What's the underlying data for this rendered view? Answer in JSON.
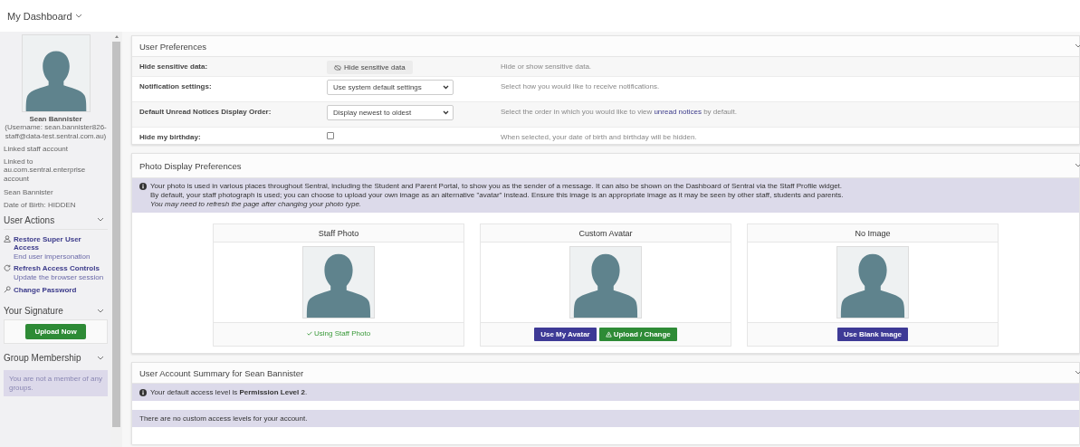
{
  "header": {
    "title": "My Dashboard"
  },
  "profile": {
    "name": "Sean Bannister",
    "username": "(Username: sean.bannister826-staff@data-test.sentral.com.au)",
    "linked": "Linked staff account",
    "linked_to": "Linked to au.com.sentral.enterprise account",
    "display_name": "Sean Bannister",
    "dob": "Date of Birth: HIDDEN"
  },
  "user_actions": {
    "title": "User Actions",
    "actions": [
      {
        "kind": "user",
        "label": "Restore Super User Access",
        "sub": "End user impersonation"
      },
      {
        "kind": "refresh",
        "label": "Refresh Access Controls",
        "sub": "Update the browser session"
      },
      {
        "kind": "key",
        "label": "Change Password"
      }
    ]
  },
  "signature": {
    "title": "Your Signature",
    "button": "Upload Now"
  },
  "groups": {
    "title": "Group Membership",
    "message": "You are not a member of any groups."
  },
  "user_preferences": {
    "title": "User Preferences",
    "rows": [
      {
        "kind": "button",
        "label": "Hide sensitive data:",
        "value": "Hide sensitive data",
        "help": "Hide or show sensitive data."
      },
      {
        "kind": "select",
        "label": "Notification settings:",
        "value": "Use system default settings",
        "help": "Select how you would like to receive notifications."
      },
      {
        "kind": "select",
        "label": "Default Unread Notices Display Order:",
        "value": "Display newest to oldest",
        "help": "Select the order in which you would like to view",
        "link": "unread notices",
        "help_after": "by default."
      },
      {
        "kind": "checkbox",
        "label": "Hide my birthday:",
        "checked": false,
        "help": "When selected, your date of birth and birthday will be hidden."
      }
    ]
  },
  "photo_preferences": {
    "title": "Photo Display Preferences",
    "info": [
      "Your photo is used in various places throughout Sentral, including the Student and Parent Portal, to show you as the sender of a message. It can also be shown on the Dashboard of Sentral via the Staff Profile widget.",
      "By default, your staff photograph is used; you can choose to upload your own image as an alternative \"avatar\" instead. Ensure this image is an appropriate image as it may be seen by other staff, students and parents."
    ],
    "note": "You may need to refresh the page after changing your photo type.",
    "cards": [
      {
        "title": "Staff Photo",
        "status": "Using Staff Photo"
      },
      {
        "title": "Custom Avatar",
        "buttons": [
          {
            "kind": "primary",
            "label": "Use My Avatar"
          },
          {
            "kind": "success",
            "label": "Upload / Change"
          }
        ]
      },
      {
        "title": "No Image",
        "buttons": [
          {
            "kind": "primary",
            "label": "Use Blank Image"
          }
        ]
      }
    ]
  },
  "account_summary": {
    "title": "User Account Summary for Sean Bannister",
    "access": "Your default access level is **Permission Level 2**.",
    "custom": "There are no custom access levels for your account."
  }
}
